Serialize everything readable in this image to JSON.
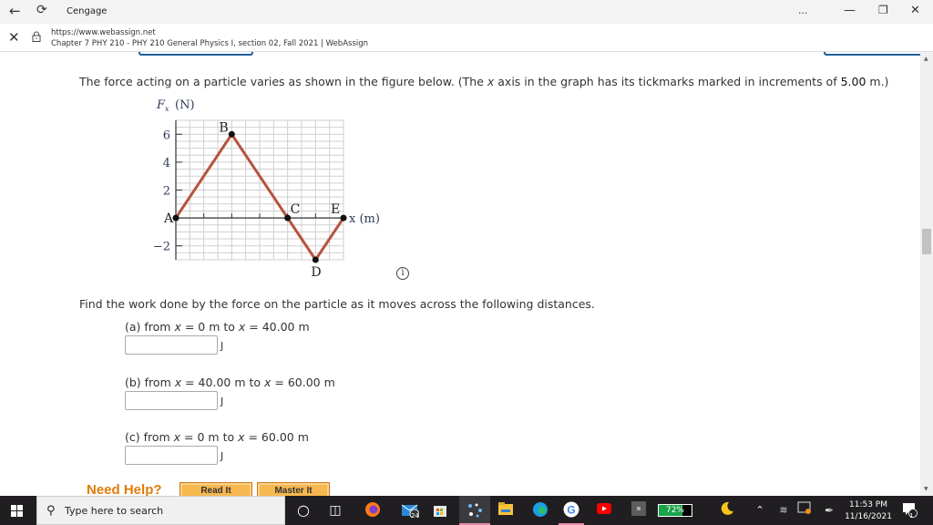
{
  "browser": {
    "app_title": "Cengage",
    "url": "https://www.webassign.net",
    "page_title": "Chapter 7 PHY 210 - PHY 210 General Physics I, section 02, Fall 2021 | WebAssign",
    "menu_label": "...",
    "icons": [
      "back-arrow-icon",
      "refresh-icon",
      "close-icon",
      "lock-icon",
      "minimize-icon",
      "restore-icon",
      "window-close-icon"
    ]
  },
  "question": {
    "intro_before_x": "The force acting on a particle varies as shown in the figure below. (The ",
    "x_var": "x",
    "intro_after_x": " axis in the graph has its tickmarks marked in increments of ",
    "increment": "5.00",
    "intro_end": " m.)",
    "find_text": "Find the work done by the force on the particle as it moves across the following distances.",
    "parts": [
      {
        "label": "(a) from ",
        "x1_var": "x",
        "eq1": " = 0 m to ",
        "x2_var": "x",
        "eq2": " = 40.00 m",
        "input_value": "",
        "unit": "J"
      },
      {
        "label": "(b) from ",
        "x1_var": "x",
        "eq1": " = 40.00 m to ",
        "x2_var": "x",
        "eq2": " = 60.00 m",
        "input_value": "",
        "unit": "J"
      },
      {
        "label": "(c) from ",
        "x1_var": "x",
        "eq1": " = 0 m to ",
        "x2_var": "x",
        "eq2": " = 60.00 m",
        "input_value": "",
        "unit": "J"
      }
    ],
    "info_icon": "i"
  },
  "help": {
    "label": "Need Help?",
    "read_it": "Read It",
    "master_it": "Master It"
  },
  "chart_data": {
    "type": "line",
    "title": "",
    "ylabel": "Fx (N)",
    "xlabel": "x (m)",
    "ytick_labels": [
      "6",
      "4",
      "2",
      "−2"
    ],
    "yticks": [
      6,
      4,
      2,
      -2
    ],
    "ylim": [
      -3,
      7
    ],
    "xtick_count": 6,
    "xtick_increment_m": 5,
    "xlim_ticks": [
      0,
      6
    ],
    "grid": true,
    "series": [
      {
        "name": "Fx",
        "color": "#b5533c",
        "points": [
          {
            "label": "A",
            "x_ticks": 0,
            "y": 0
          },
          {
            "label": "B",
            "x_ticks": 2,
            "y": 6
          },
          {
            "label": "C",
            "x_ticks": 4,
            "y": 0
          },
          {
            "label": "D",
            "x_ticks": 5,
            "y": -3
          },
          {
            "label": "E",
            "x_ticks": 6,
            "y": 0
          }
        ]
      }
    ]
  },
  "taskbar": {
    "search_placeholder": "Type here to search",
    "mail_badge": "24",
    "battery_percent": 72,
    "battery_label": "72%",
    "time": "11:53 PM",
    "date": "11/16/2021",
    "notification_count": "1"
  }
}
